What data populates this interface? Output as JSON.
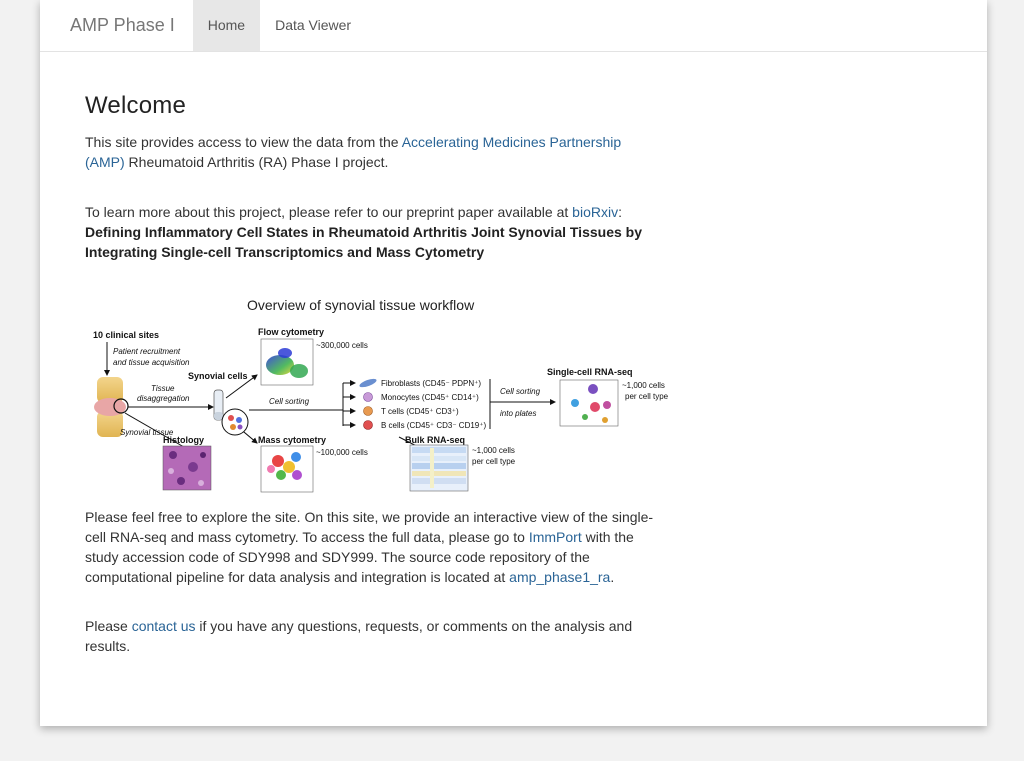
{
  "nav": {
    "brand": "AMP Phase I",
    "tabs": [
      {
        "label": "Home",
        "active": true
      },
      {
        "label": "Data Viewer",
        "active": false
      }
    ]
  },
  "welcome": {
    "heading": "Welcome",
    "intro_pre": "This site provides access to view the data from the ",
    "intro_link": "Accelerating Medicines Partnership (AMP)",
    "intro_post": " Rheumatoid Arthritis (RA) Phase I project.",
    "paper_pre": "To learn more about this project, please refer to our preprint paper available at ",
    "paper_link": "bioRxiv",
    "paper_colon": ":",
    "paper_title": "Defining Inflammatory Cell States in Rheumatoid Arthritis Joint Synovial Tissues by Integrating Single-cell Transcriptomics and Mass Cytometry"
  },
  "figure": {
    "title": "Overview of synovial tissue workflow",
    "clinical_sites": "10 clinical sites",
    "recruitment_1": "Patient recruitment",
    "recruitment_2": "and tissue acquisition",
    "tissue_1": "Tissue",
    "tissue_2": "disaggregation",
    "synovial_tissue": "Synovial tissue",
    "synovial_cells": "Synovial cells",
    "histology": "Histology",
    "flow_cytometry": "Flow cytometry",
    "flow_count": "~300,000 cells",
    "mass_cytometry": "Mass cytometry",
    "mass_count": "~100,000 cells",
    "cell_sorting_1": "Cell sorting",
    "fibroblasts": "Fibroblasts (CD45⁻ PDPN⁺)",
    "monocytes": "Monocytes (CD45⁺ CD14⁺)",
    "t_cells": "T cells (CD45⁺ CD3⁺)",
    "b_cells": "B cells (CD45⁺ CD3⁻ CD19⁺)",
    "cell_sorting_2": "Cell sorting",
    "into_plates": "into plates",
    "scrnaseq": "Single-cell RNA-seq",
    "scrnaseq_count_1": "~1,000 cells",
    "scrnaseq_count_2": "per cell type",
    "bulk": "Bulk RNA-seq",
    "bulk_count_1": "~1,000 cells",
    "bulk_count_2": "per cell type"
  },
  "explore": {
    "pre": "Please feel free to explore the site. On this site, we provide an interactive view of the single-cell RNA-seq and mass cytometry. To access the full data, please go to ",
    "immport_link": "ImmPort",
    "mid": " with the study accession code of SDY998 and SDY999. The source code repository of the computational pipeline for data analysis and integration is located at ",
    "repo_link": "amp_phase1_ra",
    "end": "."
  },
  "contact": {
    "pre": "Please ",
    "link": "contact us",
    "post": " if you have any questions, requests, or comments on the analysis and results."
  },
  "colors": {
    "link": "#2a6496",
    "nav_active_bg": "#e7e7e7",
    "page_bg": "#f2f2f2"
  }
}
